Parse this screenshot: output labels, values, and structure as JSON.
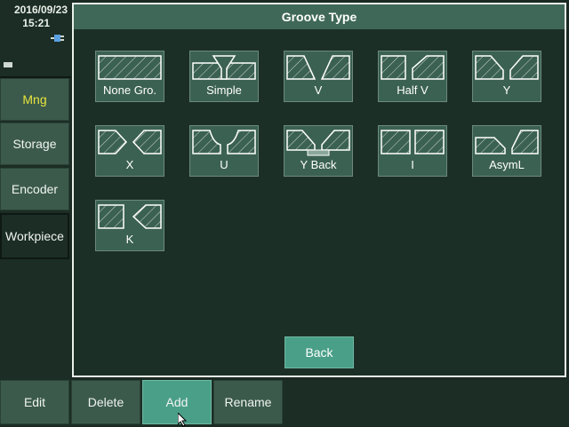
{
  "status": {
    "date": "2016/09/23",
    "time": "15:21",
    "icons": [
      "power-plug-icon",
      "battery-icon"
    ]
  },
  "sidebar": {
    "items": [
      {
        "label": "Mng",
        "state": "active"
      },
      {
        "label": "Storage",
        "state": "normal"
      },
      {
        "label": "Encoder",
        "state": "normal"
      },
      {
        "label": "Workpiece",
        "state": "selected"
      }
    ]
  },
  "dialog": {
    "title": "Groove Type",
    "grooves": [
      {
        "label": "None Gro.",
        "icon": "none-groove-icon"
      },
      {
        "label": "Simple",
        "icon": "simple-groove-icon"
      },
      {
        "label": "V",
        "icon": "v-groove-icon"
      },
      {
        "label": "Half V",
        "icon": "half-v-groove-icon"
      },
      {
        "label": "Y",
        "icon": "y-groove-icon"
      },
      {
        "label": "X",
        "icon": "x-groove-icon"
      },
      {
        "label": "U",
        "icon": "u-groove-icon"
      },
      {
        "label": "Y Back",
        "icon": "y-back-groove-icon"
      },
      {
        "label": "I",
        "icon": "i-groove-icon"
      },
      {
        "label": "AsymL",
        "icon": "asym-l-groove-icon"
      },
      {
        "label": "K",
        "icon": "k-groove-icon"
      }
    ],
    "back_label": "Back"
  },
  "bottom_bar": {
    "buttons": [
      {
        "label": "Edit"
      },
      {
        "label": "Delete"
      },
      {
        "label": "Add",
        "state": "highlighted"
      },
      {
        "label": "Rename"
      }
    ]
  },
  "colors": {
    "panel_bg": "#1c2f26",
    "button": "#3b5a4c",
    "accent": "#4a9f88",
    "active_text": "#e8e43a"
  }
}
